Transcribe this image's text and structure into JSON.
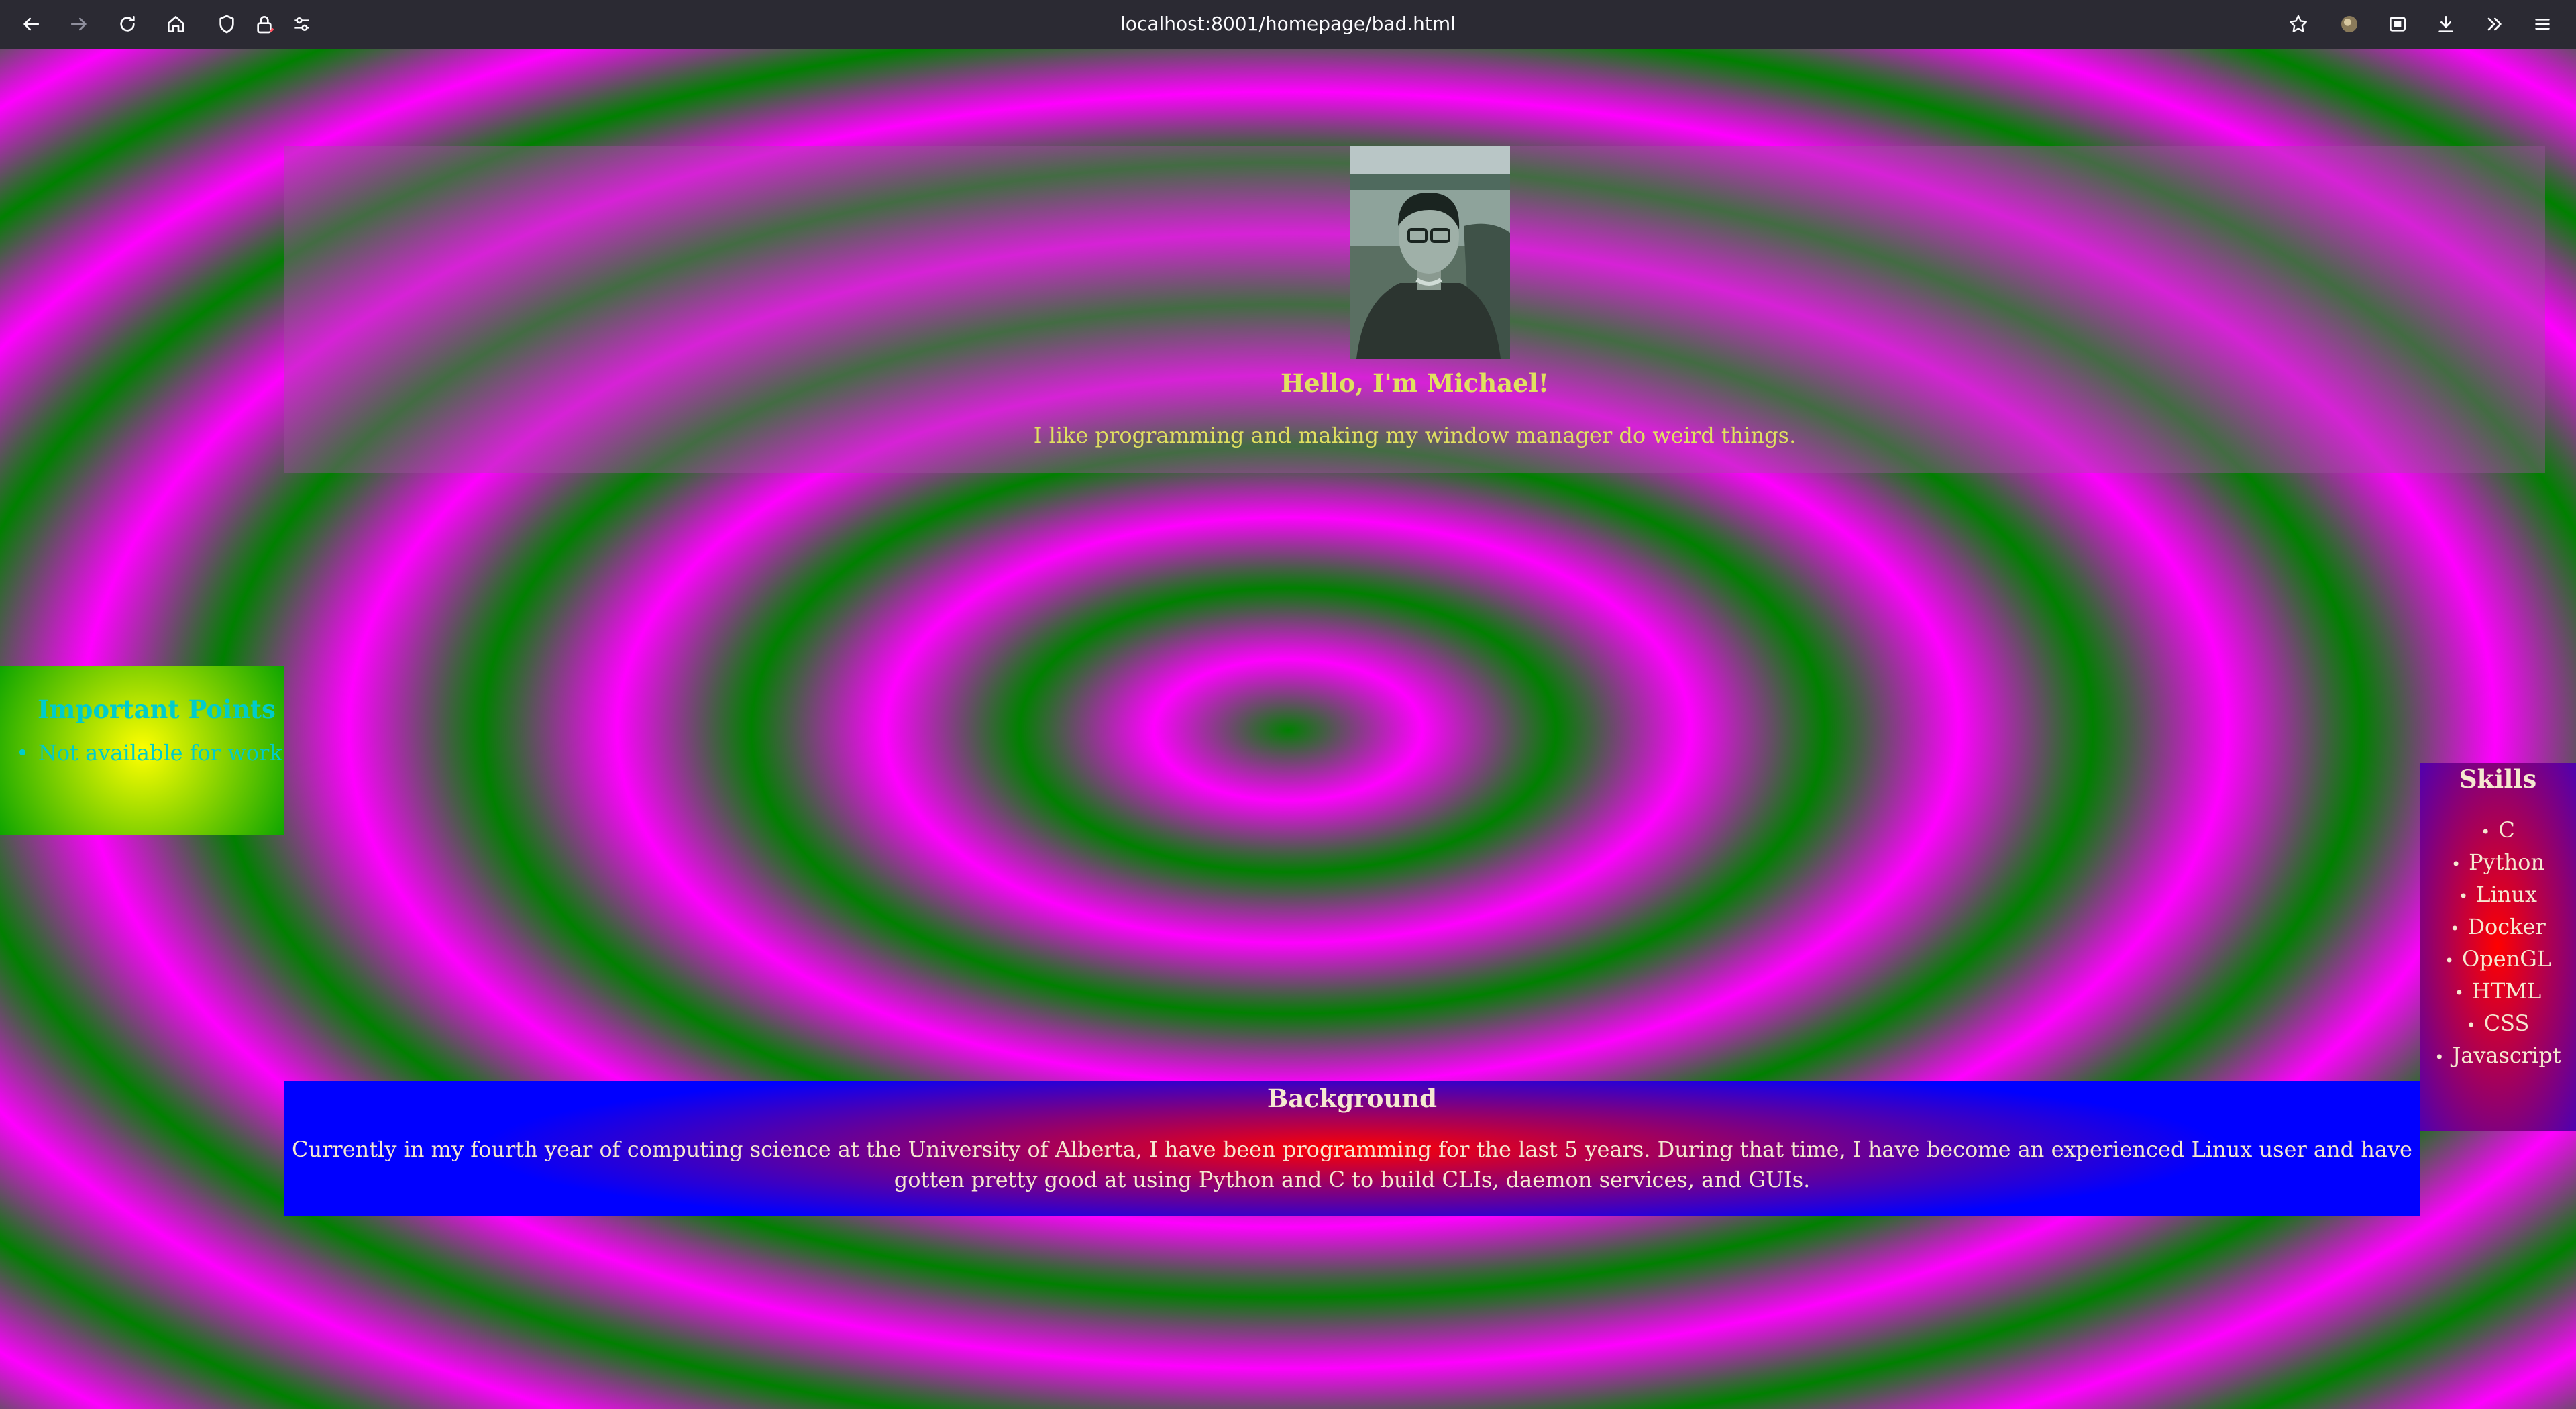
{
  "browser": {
    "url": "localhost:8001/homepage/bad.html",
    "toolbar_icons": [
      "back-icon",
      "forward-icon",
      "reload-icon",
      "home-icon",
      "shield-icon",
      "lock-icon",
      "permissions-icon",
      "bookmark-star-icon",
      "profile-avatar-icon",
      "screenshot-icon",
      "download-icon",
      "overflow-chevron-icon",
      "menu-icon"
    ]
  },
  "page": {
    "colors": {
      "ring_green": "#008000",
      "ring_magenta": "#ff00ff",
      "heading_yellow": "#e0e060",
      "important_cyan": "#00cccc",
      "panel_blue": "#0000ff",
      "panel_red": "#ff0000"
    },
    "header": {
      "title": "Hello, I'm Michael!",
      "tagline": "I like programming and making my window manager do weird things."
    },
    "important": {
      "title": "Important Points",
      "items": [
        "Not available for work"
      ]
    },
    "skills": {
      "title": "Skills",
      "items": [
        "C",
        "Python",
        "Linux",
        "Docker",
        "OpenGL",
        "HTML",
        "CSS",
        "Javascript"
      ]
    },
    "background": {
      "title": "Background",
      "text": "Currently in my fourth year of computing science at the University of Alberta, I have been programming for the last 5 years. During that time, I have become an experienced Linux user and have gotten pretty good at using Python and C to build CLIs, daemon services, and GUIs."
    }
  }
}
